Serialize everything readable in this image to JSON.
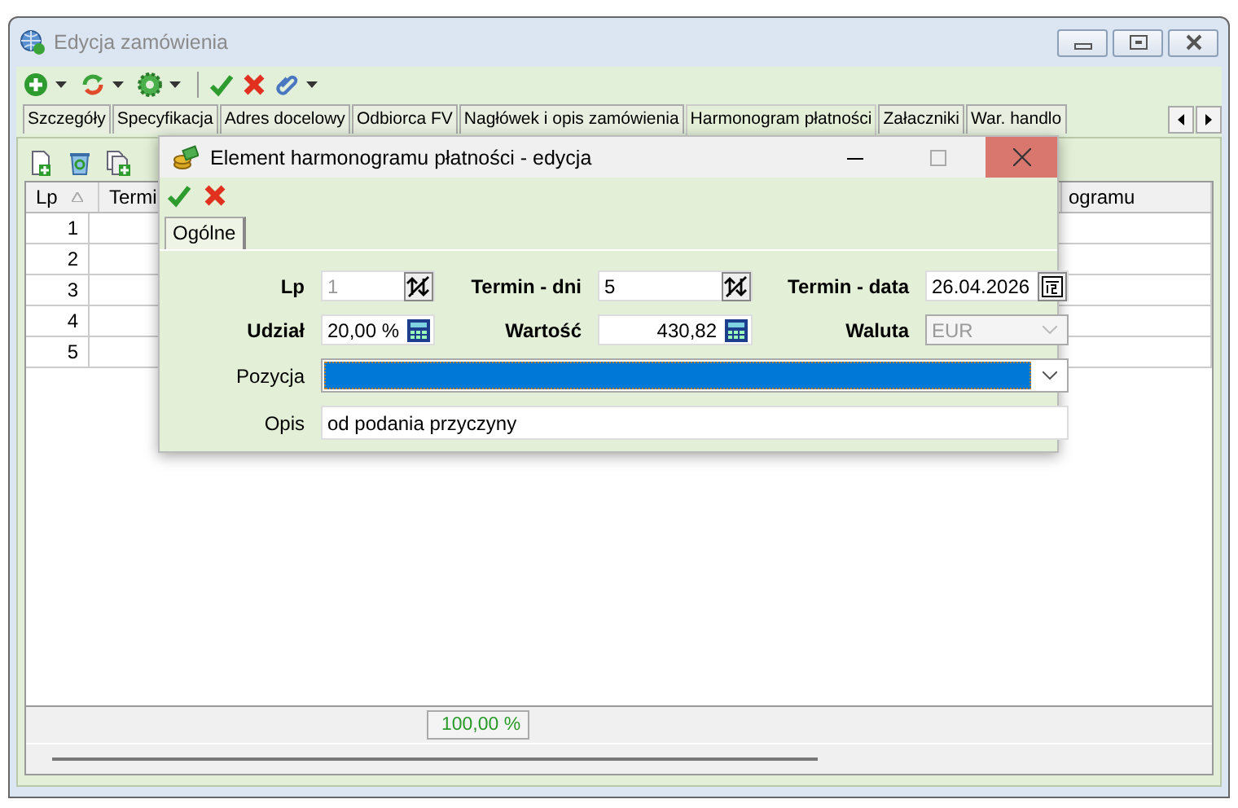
{
  "window": {
    "title": "Edycja zamówienia"
  },
  "tabs": [
    {
      "label": "Szczegóły",
      "selected": false
    },
    {
      "label": "Specyfikacja",
      "selected": false
    },
    {
      "label": "Adres docelowy",
      "selected": false
    },
    {
      "label": "Odbiorca FV",
      "selected": false
    },
    {
      "label": "Nagłówek i opis zamówienia",
      "selected": false
    },
    {
      "label": "Harmonogram płatności",
      "selected": true
    },
    {
      "label": "Załaczniki",
      "selected": false
    },
    {
      "label": "War. handlo",
      "selected": false
    }
  ],
  "grid": {
    "columns": [
      "Lp",
      "Termi",
      "ogramu"
    ],
    "rows": [
      {
        "lp": "1"
      },
      {
        "lp": "2"
      },
      {
        "lp": "3"
      },
      {
        "lp": "4"
      },
      {
        "lp": "5"
      }
    ],
    "total": "100,00 %"
  },
  "dialog": {
    "title": "Element harmonogramu płatności - edycja",
    "tabs": [
      {
        "label": "Ogólne",
        "selected": true
      }
    ],
    "fields": [
      {
        "kind": "spin",
        "label": "Lp",
        "value": "1",
        "bold": true,
        "disabled": true
      },
      {
        "kind": "spin",
        "label": "Termin - dni",
        "value": "5",
        "bold": true,
        "disabled": false
      },
      {
        "kind": "date",
        "label": "Termin - data",
        "value": "26.04.2026",
        "bold": true,
        "disabled": false
      },
      {
        "kind": "calc",
        "label": "Udział",
        "value": "20,00 %",
        "bold": true,
        "disabled": false
      },
      {
        "kind": "calc",
        "label": "Wartość",
        "value": "430,82",
        "bold": true,
        "disabled": false
      },
      {
        "kind": "combo",
        "label": "Waluta",
        "value": "EUR",
        "bold": true,
        "disabled": true
      },
      {
        "kind": "combo",
        "label": "Pozycja",
        "bold": false,
        "disabled": false,
        "highlighted": true
      },
      {
        "kind": "text",
        "label": "Opis",
        "value": "od podania przyczyny",
        "bold": false,
        "disabled": false
      }
    ]
  }
}
